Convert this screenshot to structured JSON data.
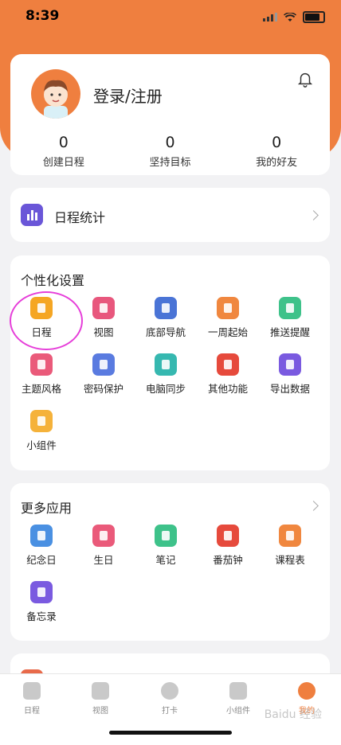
{
  "status_bar": {
    "time": "8:39"
  },
  "profile": {
    "login_label": "登录/注册",
    "stats": [
      {
        "value": "0",
        "label": "创建日程"
      },
      {
        "value": "0",
        "label": "坚持目标"
      },
      {
        "value": "0",
        "label": "我的好友"
      }
    ]
  },
  "schedule_stats": {
    "label": "日程统计"
  },
  "personalization": {
    "title": "个性化设置",
    "items": [
      {
        "label": "日程",
        "color": "#f5a623"
      },
      {
        "label": "视图",
        "color": "#e8577d"
      },
      {
        "label": "底部导航",
        "color": "#4a74d6"
      },
      {
        "label": "一周起始",
        "color": "#f0873f"
      },
      {
        "label": "推送提醒",
        "color": "#3ec28a"
      },
      {
        "label": "主题风格",
        "color": "#ea5a7a"
      },
      {
        "label": "密码保护",
        "color": "#5a7be0"
      },
      {
        "label": "电脑同步",
        "color": "#36b8b0"
      },
      {
        "label": "其他功能",
        "color": "#e64a3c"
      },
      {
        "label": "导出数据",
        "color": "#7a5ae0"
      },
      {
        "label": "小组件",
        "color": "#f5b23a"
      }
    ]
  },
  "more_apps": {
    "title": "更多应用",
    "items": [
      {
        "label": "纪念日",
        "color": "#4a90e2"
      },
      {
        "label": "生日",
        "color": "#ea5a7a"
      },
      {
        "label": "笔记",
        "color": "#3ec28a"
      },
      {
        "label": "番茄钟",
        "color": "#e64a3c"
      },
      {
        "label": "课程表",
        "color": "#f0873f"
      },
      {
        "label": "备忘录",
        "color": "#7a5ae0"
      }
    ]
  },
  "tabbar": {
    "tabs": [
      {
        "label": "日程"
      },
      {
        "label": "视图"
      },
      {
        "label": "打卡"
      },
      {
        "label": "小组件"
      },
      {
        "label": "我的"
      }
    ]
  },
  "watermark": "Baidu 经验"
}
